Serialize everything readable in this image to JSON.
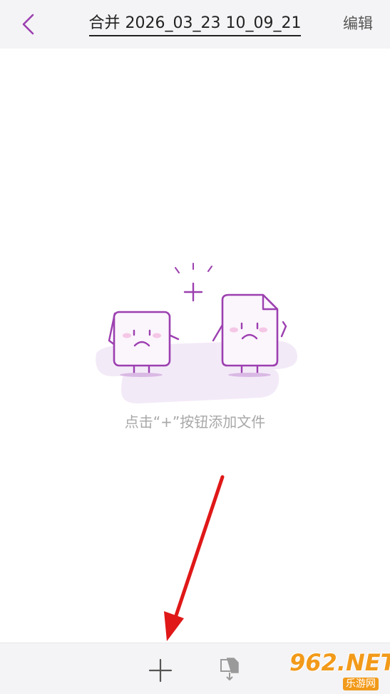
{
  "header": {
    "title": "合并 2026_03_23 10_09_21",
    "edit_label": "编辑",
    "back_icon": "chevron-left-icon"
  },
  "empty_state": {
    "hint": "点击“+”按钮添加文件"
  },
  "bottom_bar": {
    "add_icon": "plus-icon",
    "import_icon": "import-files-icon"
  },
  "watermark": {
    "logo_text": "962.NET",
    "sub_text": "乐游网"
  },
  "colors": {
    "accent": "#9c3fb0",
    "header_bg": "#f4f4f6",
    "hint_text": "#a8a8a8",
    "arrow": "#e01818",
    "watermark": "#f29a1a"
  }
}
